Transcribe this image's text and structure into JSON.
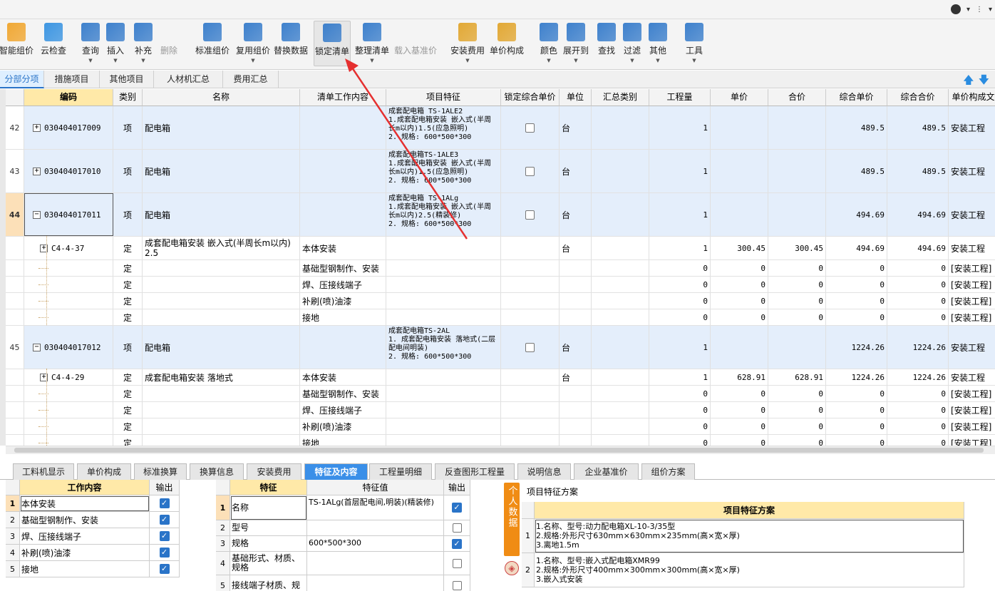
{
  "toolbar": {
    "items": [
      {
        "label": "智能组价",
        "icon": "smart-price-icon",
        "dd": false
      },
      {
        "label": "云检查",
        "icon": "cloud-check-icon",
        "dd": false
      },
      {
        "label": "查询",
        "icon": "query-icon",
        "dd": true
      },
      {
        "label": "插入",
        "icon": "insert-icon",
        "dd": true
      },
      {
        "label": "补充",
        "icon": "supplement-icon",
        "dd": true
      },
      {
        "label": "删除",
        "icon": "delete-icon",
        "dd": false
      },
      {
        "label": "标准组价",
        "icon": "standard-price-icon",
        "dd": false
      },
      {
        "label": "复用组价",
        "icon": "reuse-price-icon",
        "dd": true
      },
      {
        "label": "替换数据",
        "icon": "replace-data-icon",
        "dd": false
      },
      {
        "label": "锁定清单",
        "icon": "lock-list-icon",
        "dd": false
      },
      {
        "label": "整理清单",
        "icon": "organize-list-icon",
        "dd": true
      },
      {
        "label": "载入基准价",
        "icon": "load-base-price-icon",
        "dd": false
      },
      {
        "label": "安装费用",
        "icon": "install-fee-icon",
        "dd": true
      },
      {
        "label": "单价构成",
        "icon": "unit-price-icon",
        "dd": false
      },
      {
        "label": "颜色",
        "icon": "color-icon",
        "dd": true
      },
      {
        "label": "展开到",
        "icon": "expand-to-icon",
        "dd": true
      },
      {
        "label": "查找",
        "icon": "find-icon",
        "dd": false
      },
      {
        "label": "过滤",
        "icon": "filter-icon",
        "dd": true
      },
      {
        "label": "其他",
        "icon": "other-icon",
        "dd": true
      },
      {
        "label": "工具",
        "icon": "tools-icon",
        "dd": true
      }
    ]
  },
  "tabs": [
    "分部分项",
    "措施项目",
    "其他项目",
    "人材机汇总",
    "费用汇总"
  ],
  "grid": {
    "headers": [
      "编码",
      "类别",
      "名称",
      "清单工作内容",
      "项目特征",
      "锁定综合单价",
      "单位",
      "汇总类别",
      "工程量",
      "单价",
      "合价",
      "综合单价",
      "综合合价",
      "单价构成文"
    ],
    "rows": [
      {
        "num": "42",
        "code": "030404017009",
        "cat": "项",
        "name": "配电箱",
        "work": "",
        "feat": "成套配电箱 TS-1ALE2\n1.成套配电箱安装 嵌入式(半周长m以内)1.5(应急照明)\n2. 规格: 600*500*300",
        "unit": "台",
        "qty": "1",
        "price": "",
        "total": "",
        "cprice": "489.5",
        "ctotal": "489.5",
        "comp": "安装工程"
      },
      {
        "num": "43",
        "code": "030404017010",
        "cat": "项",
        "name": "配电箱",
        "work": "",
        "feat": "成套配电箱TS-1ALE3\n1.成套配电箱安装 嵌入式(半周长m以内)1.5(应急照明)\n2. 规格: 600*500*300",
        "unit": "台",
        "qty": "1",
        "price": "",
        "total": "",
        "cprice": "489.5",
        "ctotal": "489.5",
        "comp": "安装工程"
      },
      {
        "num": "44",
        "code": "030404017011",
        "cat": "项",
        "name": "配电箱",
        "work": "",
        "feat": "成套配电箱 TS-1ALg\n1.成套配电箱安装 嵌入式(半周长m以内)2.5(精装修)\n2. 规格: 600*500*300",
        "unit": "台",
        "qty": "1",
        "price": "",
        "total": "",
        "cprice": "494.69",
        "ctotal": "494.69",
        "comp": "安装工程"
      },
      {
        "num": "",
        "code": "C4-4-37",
        "cat": "定",
        "name": "成套配电箱安装 嵌入式(半周长m以内) 2.5",
        "work": "本体安装",
        "feat": "",
        "unit": "台",
        "qty": "1",
        "price": "300.45",
        "total": "300.45",
        "cprice": "494.69",
        "ctotal": "494.69",
        "comp": "安装工程"
      },
      {
        "num": "",
        "code": "",
        "cat": "定",
        "name": "",
        "work": "基础型钢制作、安装",
        "feat": "",
        "unit": "",
        "qty": "0",
        "price": "0",
        "total": "0",
        "cprice": "0",
        "ctotal": "0",
        "comp": "[安装工程]"
      },
      {
        "num": "",
        "code": "",
        "cat": "定",
        "name": "",
        "work": "焊、压接线端子",
        "feat": "",
        "unit": "",
        "qty": "0",
        "price": "0",
        "total": "0",
        "cprice": "0",
        "ctotal": "0",
        "comp": "[安装工程]"
      },
      {
        "num": "",
        "code": "",
        "cat": "定",
        "name": "",
        "work": "补刷(喷)油漆",
        "feat": "",
        "unit": "",
        "qty": "0",
        "price": "0",
        "total": "0",
        "cprice": "0",
        "ctotal": "0",
        "comp": "[安装工程]"
      },
      {
        "num": "",
        "code": "",
        "cat": "定",
        "name": "",
        "work": "接地",
        "feat": "",
        "unit": "",
        "qty": "0",
        "price": "0",
        "total": "0",
        "cprice": "0",
        "ctotal": "0",
        "comp": "[安装工程]"
      },
      {
        "num": "45",
        "code": "030404017012",
        "cat": "项",
        "name": "配电箱",
        "work": "",
        "feat": "成套配电箱TS-2AL\n1. 成套配电箱安装 落地式(二层配电间明装)\n2. 规格: 600*500*300",
        "unit": "台",
        "qty": "1",
        "price": "",
        "total": "",
        "cprice": "1224.26",
        "ctotal": "1224.26",
        "comp": "安装工程"
      },
      {
        "num": "",
        "code": "C4-4-29",
        "cat": "定",
        "name": "成套配电箱安装 落地式",
        "work": "本体安装",
        "feat": "",
        "unit": "台",
        "qty": "1",
        "price": "628.91",
        "total": "628.91",
        "cprice": "1224.26",
        "ctotal": "1224.26",
        "comp": "安装工程"
      },
      {
        "num": "",
        "code": "",
        "cat": "定",
        "name": "",
        "work": "基础型钢制作、安装",
        "feat": "",
        "unit": "",
        "qty": "0",
        "price": "0",
        "total": "0",
        "cprice": "0",
        "ctotal": "0",
        "comp": "[安装工程]"
      },
      {
        "num": "",
        "code": "",
        "cat": "定",
        "name": "",
        "work": "焊、压接线端子",
        "feat": "",
        "unit": "",
        "qty": "0",
        "price": "0",
        "total": "0",
        "cprice": "0",
        "ctotal": "0",
        "comp": "[安装工程]"
      },
      {
        "num": "",
        "code": "",
        "cat": "定",
        "name": "",
        "work": "补刷(喷)油漆",
        "feat": "",
        "unit": "",
        "qty": "0",
        "price": "0",
        "total": "0",
        "cprice": "0",
        "ctotal": "0",
        "comp": "[安装工程]"
      },
      {
        "num": "",
        "code": "",
        "cat": "定",
        "name": "",
        "work": "接地",
        "feat": "",
        "unit": "",
        "qty": "0",
        "price": "0",
        "total": "0",
        "cprice": "0",
        "ctotal": "0",
        "comp": "[安装工程]"
      }
    ]
  },
  "bottom_tabs": [
    "工料机显示",
    "单价构成",
    "标准换算",
    "换算信息",
    "安装费用",
    "特征及内容",
    "工程量明细",
    "反查图形工程量",
    "说明信息",
    "企业基准价",
    "组价方案"
  ],
  "work_panel": {
    "headers": [
      "工作内容",
      "输出"
    ],
    "rows": [
      {
        "n": "1",
        "label": "本体安装"
      },
      {
        "n": "2",
        "label": "基础型钢制作、安装"
      },
      {
        "n": "3",
        "label": "焊、压接线端子"
      },
      {
        "n": "4",
        "label": "补刷(喷)油漆"
      },
      {
        "n": "5",
        "label": "接地"
      }
    ]
  },
  "feature_panel": {
    "headers": [
      "特征",
      "特征值",
      "输出"
    ],
    "rows": [
      {
        "n": "1",
        "name": "名称",
        "value": "TS-1ALg(首层配电间,明装)(精装修)",
        "checked": true
      },
      {
        "n": "2",
        "name": "型号",
        "value": "",
        "checked": false
      },
      {
        "n": "3",
        "name": "规格",
        "value": "600*500*300",
        "checked": true
      },
      {
        "n": "4",
        "name": "基础形式、材质、规格",
        "value": "",
        "checked": false
      },
      {
        "n": "5",
        "name": "接线端子材质、规",
        "value": "",
        "checked": false
      }
    ]
  },
  "scheme_panel": {
    "title": "项目特征方案",
    "side_label": "个人数据",
    "header": "项目特征方案",
    "rows": [
      {
        "n": "1",
        "lines": [
          "1.名称、型号:动力配电箱XL-10-3/35型",
          "2.规格:外形尺寸630mm×630mm×235mm(高×宽×厚)",
          "3.离地1.5m"
        ]
      },
      {
        "n": "2",
        "lines": [
          "1.名称、型号:嵌入式配电箱XMR99",
          "2.规格:外形尺寸400mm×300mm×300mm(高×宽×厚)",
          "3.嵌入式安装"
        ]
      }
    ]
  },
  "accent_color": "#2a74c8",
  "annotation_color": "#e53030"
}
